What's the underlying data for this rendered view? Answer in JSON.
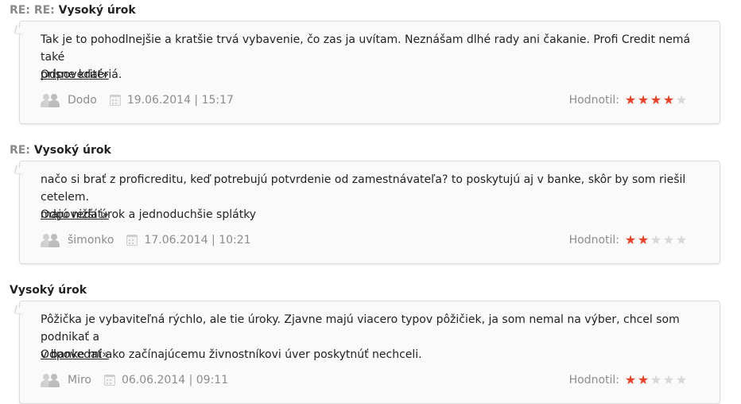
{
  "comments": [
    {
      "re_prefix": "RE: RE:",
      "title": "Vysoký úrok",
      "text_line1": "Tak je to pohodlnejšie a kratšie trvá vybavenie, čo zas ja uvítam. Neznášam dlhé rady ani čakanie. Profi Credit nemá také",
      "text_line2": "prísne kritériá.",
      "reply_label": "Odpovedať»",
      "author": "Dodo",
      "datetime": "19.06.2014 | 15:17",
      "rating_label": "Hodnotil:",
      "rating": 4,
      "rating_max": 5
    },
    {
      "re_prefix": "RE:",
      "title": "Vysoký úrok",
      "text_line1": "načo si brať z proficreditu, keď potrebujú potvrdenie od zamestnávateľa? to poskytujú aj v banke, skôr by som riešil cetelem.",
      "text_line2": "majú nižší úrok a jednoduchšie splátky",
      "reply_label": "Odpovedať»",
      "author": "šimonko",
      "datetime": "17.06.2014 | 10:21",
      "rating_label": "Hodnotil:",
      "rating": 2,
      "rating_max": 5
    },
    {
      "re_prefix": "",
      "title": "Vysoký úrok",
      "text_line1": "Pôžička je vybaviteľná rýchlo, ale tie úroky. Zjavne majú viacero typov pôžičiek, ja som nemal na výber, chcel som podnikať a",
      "text_line2": "v banke mi ako začínajúcemu živnostníkovi úver poskytnúť nechceli.",
      "reply_label": "Odpovedať»",
      "author": "Miro",
      "datetime": "06.06.2014 | 09:11",
      "rating_label": "Hodnotil:",
      "rating": 2,
      "rating_max": 5
    }
  ],
  "colors": {
    "star_on": "#e8432a",
    "star_off": "#d8d8d8",
    "meta_text": "#8d8d8d",
    "re_prefix": "#8a8a8a"
  },
  "icons": {
    "author": "user-icon",
    "date": "calendar-icon",
    "rating": "star-icon"
  }
}
